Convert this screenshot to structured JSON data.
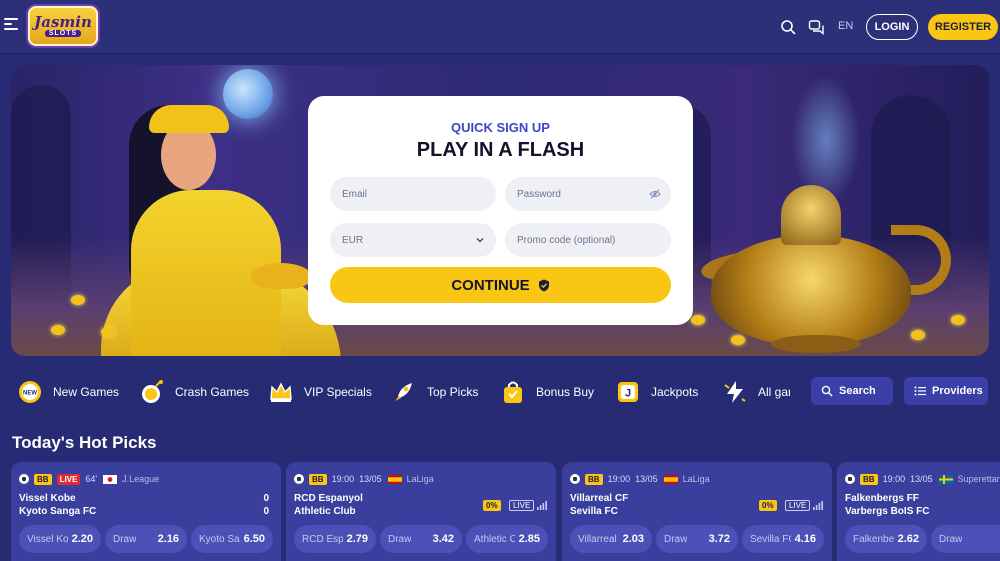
{
  "header": {
    "logo_text": "Jasmin",
    "logo_sub": "SLOTS",
    "language": "EN",
    "login_label": "LOGIN",
    "register_label": "REGISTER",
    "icons": [
      "menu-icon",
      "search-icon",
      "chat-icon"
    ]
  },
  "signup": {
    "kicker": "QUICK SIGN UP",
    "title": "PLAY IN A FLASH",
    "email_placeholder": "Email",
    "password_placeholder": "Password",
    "currency": "EUR",
    "promo_placeholder": "Promo code (optional)",
    "continue_label": "CONTINUE"
  },
  "categories": [
    {
      "label": "New Games",
      "icon": "new-badge-icon"
    },
    {
      "label": "Crash Games",
      "icon": "bomb-icon"
    },
    {
      "label": "VIP Specials",
      "icon": "crown-icon"
    },
    {
      "label": "Top Picks",
      "icon": "rocket-icon"
    },
    {
      "label": "Bonus Buy",
      "icon": "bag-icon"
    },
    {
      "label": "Jackpots",
      "icon": "jackpot-icon"
    },
    {
      "label": "All games",
      "icon": "lightning-icon"
    }
  ],
  "search_label": "Search",
  "providers_label": "Providers",
  "section_title": "Today's Hot Picks",
  "matches": [
    {
      "badge": "BB",
      "live": "LIVE",
      "time": "64'",
      "league": "J.League",
      "home": "Vissel Kobe",
      "away": "Kyoto Sanga FC",
      "home_score": "0",
      "away_score": "0",
      "odds": [
        {
          "label": "Vissel Kobe",
          "value": "2.20"
        },
        {
          "label": "Draw",
          "value": "2.16"
        },
        {
          "label": "Kyoto Sanga FC",
          "value": "6.50"
        }
      ]
    },
    {
      "badge": "BB",
      "time": "19:00",
      "date": "13/05",
      "league": "LaLiga",
      "home": "RCD Espanyol",
      "away": "Athletic Club",
      "pct": "0%",
      "live": "LIVE",
      "odds": [
        {
          "label": "RCD Espanyol",
          "value": "2.79"
        },
        {
          "label": "Draw",
          "value": "3.42"
        },
        {
          "label": "Athletic Club",
          "value": "2.85"
        }
      ]
    },
    {
      "badge": "BB",
      "time": "19:00",
      "date": "13/05",
      "league": "LaLiga",
      "home": "Villarreal CF",
      "away": "Sevilla FC",
      "pct": "0%",
      "live": "LIVE",
      "odds": [
        {
          "label": "Villarreal CF",
          "value": "2.03"
        },
        {
          "label": "Draw",
          "value": "3.72"
        },
        {
          "label": "Sevilla FC",
          "value": "4.16"
        }
      ]
    },
    {
      "badge": "BB",
      "time": "19:00",
      "date": "13/05",
      "league": "Superettan",
      "home": "Falkenbergs FF",
      "away": "Varbergs BoIS FC",
      "odds": [
        {
          "label": "Falkenbergs FF",
          "value": "2.62"
        },
        {
          "label": "Draw",
          "value": ""
        }
      ]
    }
  ],
  "colors": {
    "accent": "#f8c613",
    "bg": "#262b73",
    "card": "#3a3f9e",
    "live": "#e02b35",
    "brand_blue": "#3f45c8"
  }
}
